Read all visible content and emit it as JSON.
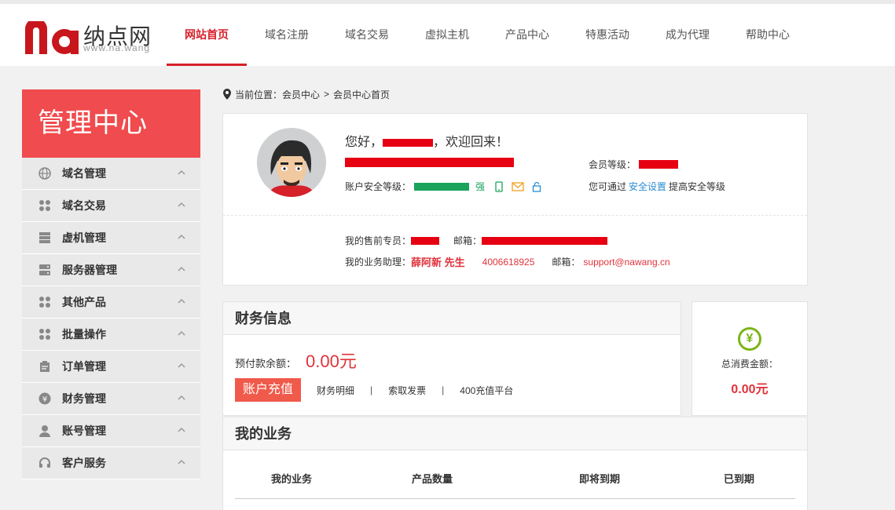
{
  "logo": {
    "cn": "纳点网",
    "en": "www.na.wang",
    "mark": "na"
  },
  "nav": [
    {
      "label": "网站首页",
      "active": true
    },
    {
      "label": "域名注册"
    },
    {
      "label": "域名交易"
    },
    {
      "label": "虚拟主机"
    },
    {
      "label": "产品中心"
    },
    {
      "label": "特惠活动"
    },
    {
      "label": "成为代理"
    },
    {
      "label": "帮助中心"
    }
  ],
  "sidebar": {
    "title": "管理中心",
    "items": [
      {
        "label": "域名管理",
        "icon": "globe-icon"
      },
      {
        "label": "域名交易",
        "icon": "grid-icon"
      },
      {
        "label": "虚机管理",
        "icon": "server-rack-icon"
      },
      {
        "label": "服务器管理",
        "icon": "server-icon"
      },
      {
        "label": "其他产品",
        "icon": "grid-icon"
      },
      {
        "label": "批量操作",
        "icon": "grid-icon"
      },
      {
        "label": "订单管理",
        "icon": "clipboard-icon"
      },
      {
        "label": "财务管理",
        "icon": "yen-coin-icon"
      },
      {
        "label": "账号管理",
        "icon": "user-icon"
      },
      {
        "label": "客户服务",
        "icon": "headset-icon"
      }
    ]
  },
  "breadcrumb": {
    "prefix": "当前位置：",
    "parent": "会员中心",
    "separator": ">",
    "current": "会员中心首页"
  },
  "user": {
    "greet_prefix": "您好，",
    "greet_suffix": "，欢迎回来！",
    "level_label": "会员等级：",
    "security_label": "账户安全等级：",
    "security_strength": "强",
    "tip_prefix": "您可通过",
    "tip_link": "安全设置",
    "tip_suffix": "提高安全等级",
    "rep_label": "我的售前专员：",
    "rep_email_label": "邮箱：",
    "assistant_label": "我的业务助理：",
    "assistant_name": "薛阿新 先生",
    "assistant_phone": "4006618925",
    "assistant_email_label": "邮箱：",
    "assistant_email": "support@nawang.cn"
  },
  "finance": {
    "title": "财务信息",
    "balance_label": "预付款余额：",
    "balance_value": "0.00元",
    "recharge_label": "账户充值",
    "links": [
      "财务明细",
      "索取发票",
      "400充值平台"
    ],
    "separator": "|"
  },
  "total": {
    "label": "总消费金额：",
    "value": "0.00元",
    "icon": "yen-circle-icon"
  },
  "business": {
    "title": "我的业务",
    "columns": [
      "我的业务",
      "产品数量",
      "即将到期",
      "已到期"
    ]
  },
  "colors": {
    "brand_red": "#d6202a",
    "sidebar_header": "#f04b4e",
    "security_green": "#1aa35b",
    "link_blue": "#2a8bd1",
    "yen_green": "#7cb518"
  }
}
